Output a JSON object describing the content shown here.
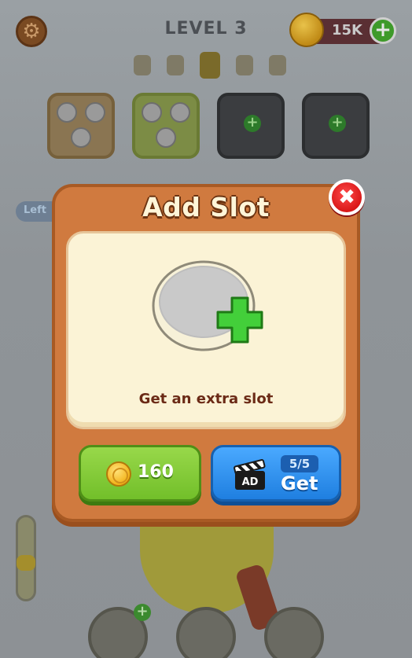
{
  "hud": {
    "level_label": "LEVEL 3",
    "coins_amount": "15K",
    "settings_icon": "gear-icon",
    "add_coins_icon": "plus-icon"
  },
  "side": {
    "left_tag": "Left"
  },
  "modal": {
    "title": "Add Slot",
    "caption": "Get an extra slot",
    "close_icon": "close-icon",
    "coin_button": {
      "price": "160",
      "icon": "coin-icon"
    },
    "ad_button": {
      "badge": "AD",
      "count": "5/5",
      "label": "Get",
      "icon": "clapperboard-icon"
    }
  },
  "colors": {
    "modal_bg": "#d07a3f",
    "panel_bg": "#fbf3d6",
    "coin_button": "#72bf2a",
    "ad_button": "#1f7fe0",
    "close_button": "#e02222",
    "plus_green": "#3fc43a"
  }
}
